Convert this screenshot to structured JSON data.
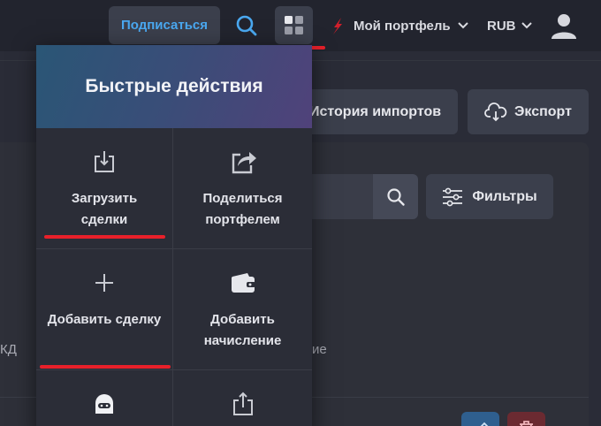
{
  "topbar": {
    "subscribe_label": "Подписаться",
    "portfolio_label": "Мой портфель",
    "currency_label": "RUB"
  },
  "page": {
    "history_label": "История импортов",
    "export_label": "Экспорт",
    "filters_label": "Фильтры",
    "fragment_left": "КД",
    "fragment_right": "ие"
  },
  "quick_actions": {
    "title": "Быстрые действия",
    "items": [
      {
        "label": "Загрузить сделки",
        "icon": "download-tray-icon"
      },
      {
        "label": "Поделиться портфелем",
        "icon": "share-arrow-icon"
      },
      {
        "label": "Добавить сделку",
        "icon": "plus-icon"
      },
      {
        "label": "Добавить начисление",
        "icon": "wallet-icon"
      },
      {
        "label": "",
        "icon": "bot-icon"
      },
      {
        "label": "",
        "icon": "upload-tray-icon"
      }
    ]
  },
  "colors": {
    "accent_blue": "#4aa8f0",
    "highlight_red": "#e8202a",
    "header_gradient_start": "#2a5676",
    "header_gradient_end": "#50427a"
  }
}
